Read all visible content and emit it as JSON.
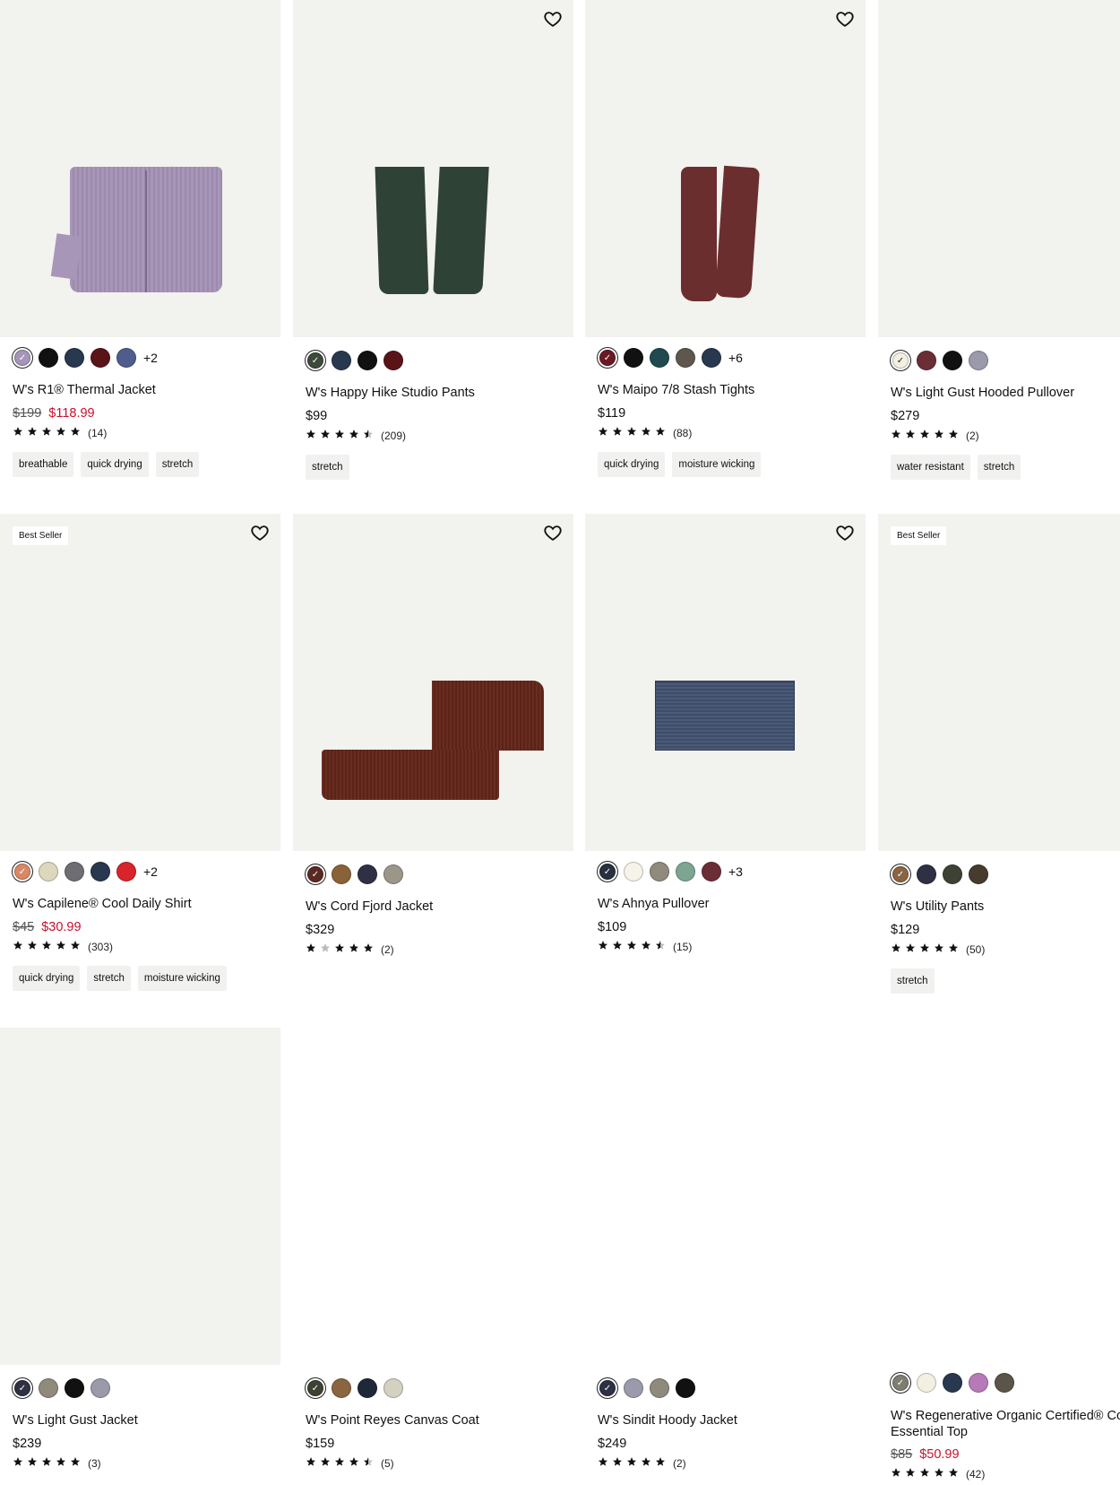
{
  "products": [
    {
      "name": "W's R1® Thermal Jacket",
      "price_original": "$199",
      "price": "$118.99",
      "rating": 5,
      "reviews": "(14)",
      "tags": [
        "breathable",
        "quick drying",
        "stretch"
      ],
      "swatches": [
        "#a596b8",
        "#111111",
        "#27384f",
        "#5a1418",
        "#4e5d8c"
      ],
      "more_colors": "+2",
      "favorite": false,
      "badge": "",
      "image_color": "#a896b8",
      "image_kind": "jacket"
    },
    {
      "name": "W's Happy Hike Studio Pants",
      "price_original": "",
      "price": "$99",
      "rating": 4.5,
      "reviews": "(209)",
      "tags": [
        "stretch"
      ],
      "swatches": [
        "#3d4a3c",
        "#27384f",
        "#111111",
        "#5a1418"
      ],
      "more_colors": "",
      "favorite": true,
      "badge": "",
      "image_color": "#2f4236",
      "image_kind": "pants"
    },
    {
      "name": "W's Maipo 7/8 Stash Tights",
      "price_original": "",
      "price": "$119",
      "rating": 5,
      "reviews": "(88)",
      "tags": [
        "quick drying",
        "moisture wicking"
      ],
      "swatches": [
        "#6a1a22",
        "#111111",
        "#1f4a4e",
        "#5e574d",
        "#27384f"
      ],
      "more_colors": "+6",
      "favorite": true,
      "badge": "",
      "image_color": "#6b2e2e",
      "image_kind": "tights"
    },
    {
      "name": "W's Light Gust Hooded Pullover",
      "price_original": "",
      "price": "$279",
      "rating": 5,
      "reviews": "(2)",
      "tags": [
        "water resistant",
        "stretch"
      ],
      "swatches": [
        "#f3f0e2",
        "#6b2e36",
        "#111111",
        "#9b9aaa"
      ],
      "more_colors": "",
      "favorite": false,
      "badge": "",
      "image_color": "",
      "image_kind": "none"
    },
    {
      "name": "W's Capilene® Cool Daily Shirt",
      "price_original": "$45",
      "price": "$30.99",
      "rating": 5,
      "reviews": "(303)",
      "tags": [
        "quick drying",
        "stretch",
        "moisture wicking"
      ],
      "swatches": [
        "#d98866",
        "#ddd7bd",
        "#6e6e72",
        "#27384f",
        "#d8242a"
      ],
      "more_colors": "+2",
      "favorite": true,
      "badge": "Best Seller",
      "image_color": "",
      "image_kind": "none"
    },
    {
      "name": "W's Cord Fjord Jacket",
      "price_original": "",
      "price": "$329",
      "rating": 4,
      "reviews": "(2)",
      "tags": [],
      "swatches": [
        "#5a2a22",
        "#8a6238",
        "#2e3043",
        "#9b9688"
      ],
      "more_colors": "",
      "favorite": true,
      "badge": "",
      "image_color": "#6b2c20",
      "image_kind": "cord"
    },
    {
      "name": "W's Ahnya Pullover",
      "price_original": "",
      "price": "$109",
      "rating": 4.5,
      "reviews": "(15)",
      "tags": [],
      "swatches": [
        "#2a3040",
        "#f6f4ea",
        "#8f8a7c",
        "#7ea492",
        "#6b2e36"
      ],
      "more_colors": "+3",
      "favorite": true,
      "badge": "",
      "image_color": "#4a5a78",
      "image_kind": "fleece"
    },
    {
      "name": "W's Utility Pants",
      "price_original": "",
      "price": "$129",
      "rating": 5,
      "reviews": "(50)",
      "tags": [
        "stretch"
      ],
      "swatches": [
        "#8a6542",
        "#2e3043",
        "#3d4234",
        "#463b2c"
      ],
      "more_colors": "",
      "favorite": false,
      "badge": "Best Seller",
      "image_color": "",
      "image_kind": "none"
    },
    {
      "name": "W's Light Gust Jacket",
      "price_original": "",
      "price": "$239",
      "rating": 5,
      "reviews": "(3)",
      "tags": [],
      "swatches": [
        "#2e3043",
        "#8f8a7c",
        "#111111",
        "#9b9aaa"
      ],
      "more_colors": "",
      "favorite": false,
      "badge": "",
      "image_color": "",
      "image_kind": "none"
    },
    {
      "name": "W's Point Reyes Canvas Coat",
      "price_original": "",
      "price": "$159",
      "rating": 4.5,
      "reviews": "(5)",
      "tags": [],
      "swatches": [
        "#3d4234",
        "#8a6542",
        "#1e2838",
        "#d4d0c2"
      ],
      "more_colors": "",
      "favorite": false,
      "badge": "",
      "image_color": "",
      "image_kind": "blank"
    },
    {
      "name": "W's Sindit Hoody Jacket",
      "price_original": "",
      "price": "$249",
      "rating": 5,
      "reviews": "(2)",
      "tags": [],
      "swatches": [
        "#2e3043",
        "#9b9aaa",
        "#8f8a7c",
        "#111111"
      ],
      "more_colors": "",
      "favorite": false,
      "badge": "",
      "image_color": "",
      "image_kind": "blank"
    },
    {
      "name": "W's Regenerative Organic Certified® Cotton Essential Top",
      "price_original": "$85",
      "price": "$50.99",
      "rating": 5,
      "reviews": "(42)",
      "tags": [],
      "swatches": [
        "#7d7d72",
        "#f3f0e2",
        "#27384f",
        "#b77ab8",
        "#5a5548"
      ],
      "more_colors": "",
      "favorite": false,
      "badge": "",
      "image_color": "",
      "image_kind": "blank"
    }
  ]
}
